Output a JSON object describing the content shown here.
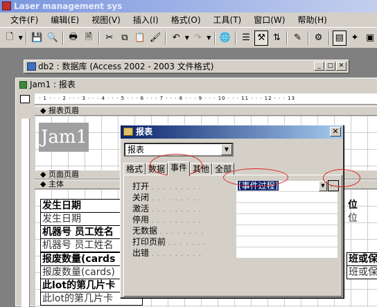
{
  "app": {
    "title": "Laser management sys"
  },
  "menu": [
    "文件(F)",
    "编辑(E)",
    "视图(V)",
    "插入(I)",
    "格式(O)",
    "工具(T)",
    "窗口(W)",
    "帮助(H)"
  ],
  "db_window": {
    "title": "db2 : 数据库 (Access 2002 - 2003 文件格式)"
  },
  "report_window": {
    "title": "Jam1 : 报表",
    "ruler": "· 1 · · · 2 · · · 3 · · · 4 · · · 5 · · · 6 · · · 7 · · · 8 · · · 9 · · · 10 · · · 11 · · · 12 · · · 13",
    "sections": {
      "report_header": "报表页眉",
      "page_header": "页面页眉",
      "detail": "主体"
    },
    "logo_text": "Jam1",
    "labels": {
      "l1": "发生日期",
      "f1": "发生日期",
      "l2": "机器号 员工姓名",
      "f2": "机器号 员工姓名",
      "l3": "报废数量(cards",
      "f3": "报废数量(cards)",
      "l4": "此lot的第几片卡",
      "f4": "此lot的第几片卡",
      "r1": "班或保",
      "r2": "班或保",
      "rt": "位",
      "rb": "位"
    }
  },
  "properties": {
    "title": "报表",
    "object": "报表",
    "tabs": [
      "格式",
      "数据",
      "事件",
      "其他",
      "全部"
    ],
    "active_tab": "事件",
    "rows": [
      "打开",
      "关闭",
      "激活",
      "停用",
      "无数据",
      "打印页前",
      "出错"
    ],
    "open_value": "[事件过程]",
    "builder_label": "..."
  }
}
